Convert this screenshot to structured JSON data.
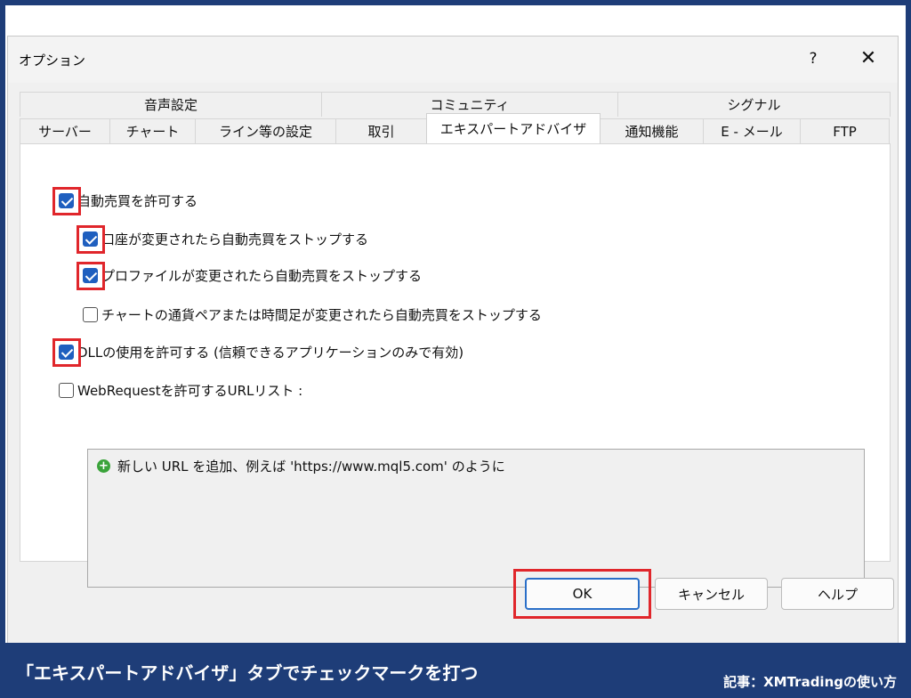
{
  "dialog": {
    "title": "オプション",
    "help_glyph": "?",
    "close_glyph": "✕"
  },
  "tabs": {
    "row1": [
      {
        "label": "音声設定"
      },
      {
        "label": "コミュニティ"
      },
      {
        "label": "シグナル"
      }
    ],
    "row2": [
      {
        "label": "サーバー"
      },
      {
        "label": "チャート"
      },
      {
        "label": "ライン等の設定"
      },
      {
        "label": "取引"
      },
      {
        "label": "エキスパートアドバイザ",
        "active": true
      },
      {
        "label": "通知機能"
      },
      {
        "label": "E - メール"
      },
      {
        "label": "FTP"
      }
    ]
  },
  "options": {
    "allow_auto_trading": {
      "label": "自動売買を許可する",
      "checked": true
    },
    "stop_on_account_change": {
      "label": "口座が変更されたら自動売買をストップする",
      "checked": true
    },
    "stop_on_profile_change": {
      "label": "プロファイルが変更されたら自動売買をストップする",
      "checked": true
    },
    "stop_on_symbol_change": {
      "label": "チャートの通貨ペアまたは時間足が変更されたら自動売買をストップする",
      "checked": false
    },
    "allow_dll": {
      "label": "DLLの使用を許可する (信頼できるアプリケーションのみで有効)",
      "checked": true
    },
    "allow_webrequest": {
      "label": "WebRequestを許可するURLリスト :",
      "checked": false
    }
  },
  "url_list": {
    "add_item": "新しい URL を追加、例えば 'https://www.mql5.com' のように",
    "add_icon": "+"
  },
  "buttons": {
    "ok": "OK",
    "cancel": "キャンセル",
    "help": "ヘルプ"
  },
  "caption": {
    "main": "「エキスパートアドバイザ」タブでチェックマークを打つ",
    "sub": "記事：XMTradingの使い方"
  },
  "colors": {
    "frame": "#1e3d78",
    "highlight": "#e0262b",
    "checkbox": "#1f5fbf"
  }
}
